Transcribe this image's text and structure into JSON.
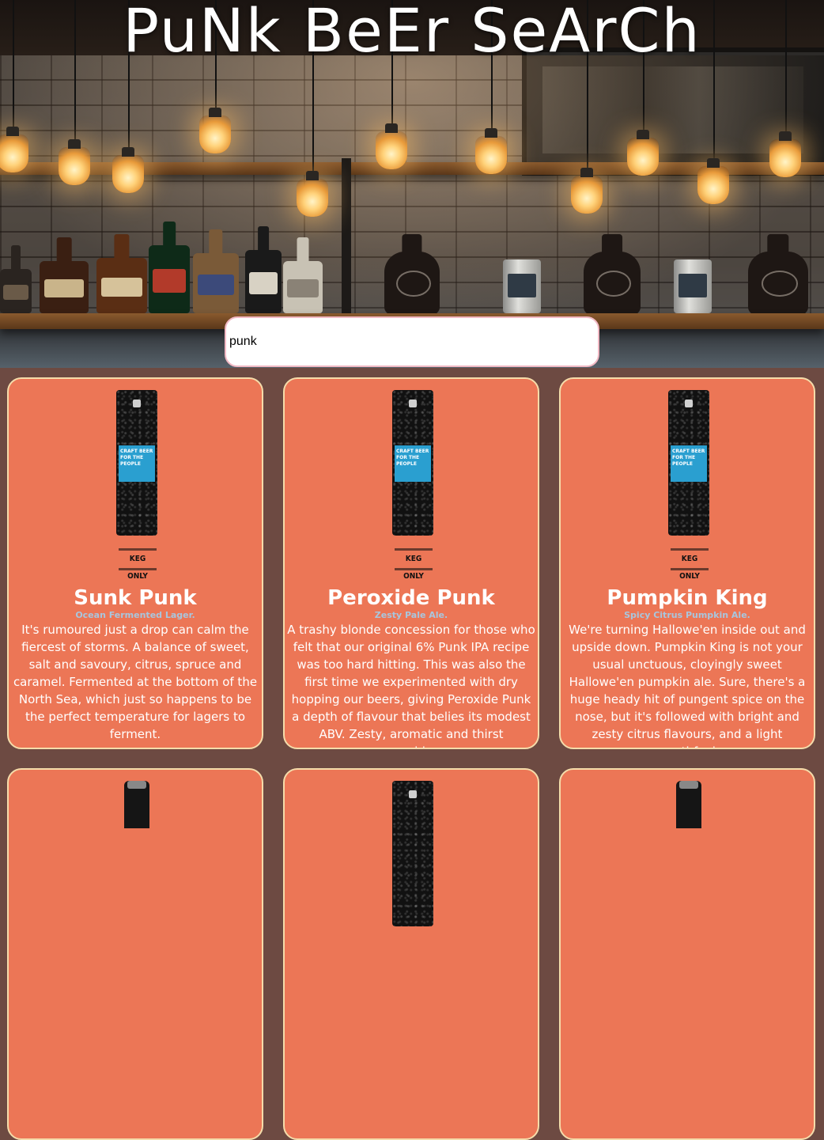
{
  "header": {
    "title": "PuNk BeEr SeArCh"
  },
  "search": {
    "value": "punk",
    "placeholder": ""
  },
  "colors": {
    "page_background": "#6d4a42",
    "card_background": "#ec7656",
    "card_border": "#f5dcaa",
    "tagline": "#a8c6de",
    "search_border": "#f2b9c4"
  },
  "beers": [
    {
      "name": "Sunk Punk",
      "tagline": "Ocean Fermented Lager.",
      "description": "It's rumoured just a drop can calm the fiercest of storms. A balance of sweet, salt and savoury, citrus, spruce and caramel. Fermented at the bottom of the North Sea, which just so happens to be the perfect temperature for lagers to ferment.",
      "image_kind": "keg",
      "keg_label": "CRAFT BEER FOR THE PEOPLE",
      "keg_base": "KEG ONLY"
    },
    {
      "name": "Peroxide Punk",
      "tagline": "Zesty Pale Ale.",
      "description": "A trashy blonde concession for those who felt that our original 6% Punk IPA recipe was too hard hitting. This was also the first time we experimented with dry hopping our beers, giving Peroxide Punk a depth of flavour that belies its modest ABV. Zesty, aromatic and thirst quenching.",
      "image_kind": "keg",
      "keg_label": "CRAFT BEER FOR THE PEOPLE",
      "keg_base": "KEG ONLY"
    },
    {
      "name": "Pumpkin King",
      "tagline": "Spicy Citrus Pumpkin Ale.",
      "description": "We're turning Hallowe'en inside out and upside down. Pumpkin King is not your usual unctuous, cloyingly sweet Hallowe'en pumpkin ale. Sure, there's a huge heady hit of pungent spice on the nose, but it's followed with bright and zesty citrus flavours, and a light mouthfeel.",
      "image_kind": "keg",
      "keg_label": "CRAFT BEER FOR THE PEOPLE",
      "keg_base": "KEG ONLY"
    },
    {
      "image_kind": "bottle"
    },
    {
      "image_kind": "keg-partial"
    },
    {
      "image_kind": "bottle"
    }
  ]
}
